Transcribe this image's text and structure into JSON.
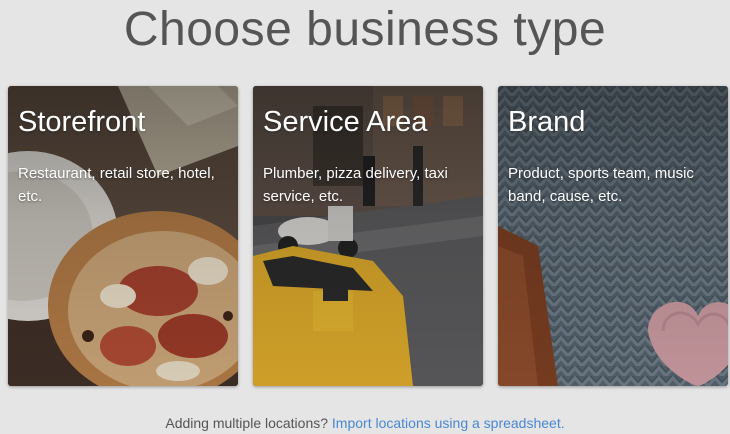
{
  "header": {
    "title": "Choose business type"
  },
  "cards": [
    {
      "title": "Storefront",
      "description": "Restaurant, retail store, hotel, etc."
    },
    {
      "title": "Service Area",
      "description": "Plumber, pizza delivery, taxi service, etc."
    },
    {
      "title": "Brand",
      "description": "Product, sports team, music band, cause, etc."
    }
  ],
  "footer": {
    "prompt": "Adding multiple locations?",
    "link": "Import locations using a spreadsheet."
  },
  "colors": {
    "background": "#e5e5e5",
    "link": "#4a87d4",
    "title": "#555555"
  },
  "icons": [
    "pizza-photo",
    "street-taxi-photo",
    "knit-sweater-photo"
  ]
}
